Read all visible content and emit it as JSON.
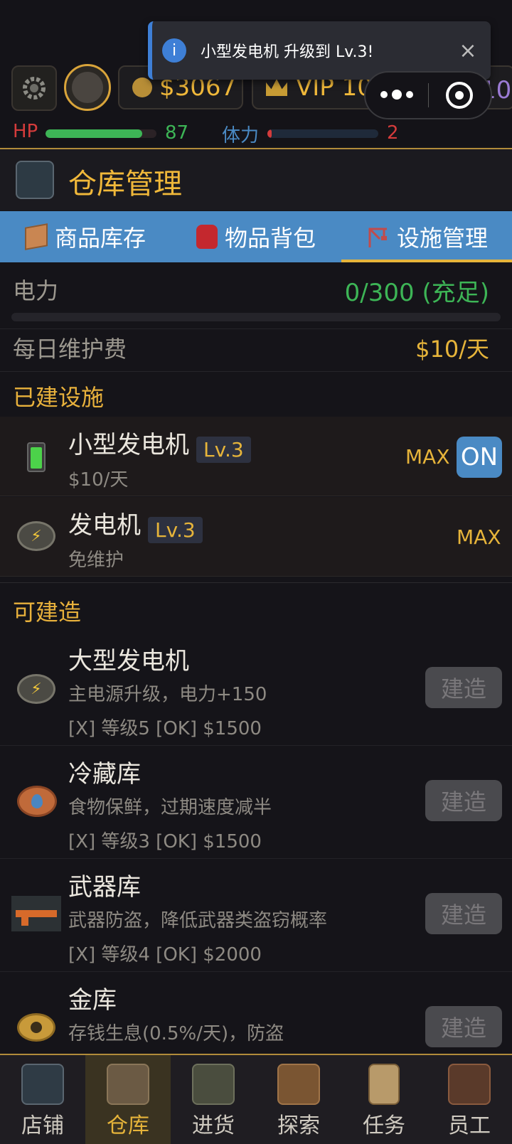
{
  "toast": {
    "icon": "info-icon",
    "message": "小型发电机 升级到 Lv.3!",
    "close": "×"
  },
  "top": {
    "money": "$3067",
    "vip": "VIP 10",
    "reputation": "声望：10",
    "hp_label": "HP",
    "hp_value": "87",
    "hp_fraction": 0.87,
    "stamina_label": "体力",
    "stamina_value": "2",
    "stamina_fraction": 0.02
  },
  "header": {
    "title": "仓库管理"
  },
  "tabs": [
    {
      "label": "商品库存",
      "icon": "box-icon"
    },
    {
      "label": "物品背包",
      "icon": "backpack-icon"
    },
    {
      "label": "设施管理",
      "icon": "crane-icon",
      "active": true
    }
  ],
  "power": {
    "label": "电力",
    "value": "0/300 (充足)",
    "fraction": 0.0
  },
  "maintenance": {
    "label": "每日维护费",
    "value": "$10/天"
  },
  "built": {
    "title": "已建设施",
    "items": [
      {
        "name": "小型发电机",
        "level": "Lv.3",
        "sub": "$10/天",
        "status": "MAX",
        "toggle": "ON",
        "icon": "battery-icon"
      },
      {
        "name": "发电机",
        "level": "Lv.3",
        "sub": "免维护",
        "status": "MAX",
        "icon": "energy-badge-icon"
      }
    ]
  },
  "buildable": {
    "title": "可建造",
    "button": "建造",
    "items": [
      {
        "name": "大型发电机",
        "desc": "主电源升级，电力+150",
        "req": "[X] 等级5  [OK] $1500",
        "icon": "energy-badge-icon"
      },
      {
        "name": "冷藏库",
        "desc": "食物保鲜，过期速度减半",
        "req": "[X] 等级3  [OK] $1500",
        "icon": "water-drop-badge-icon"
      },
      {
        "name": "武器库",
        "desc": "武器防盗，降低武器类盗窃概率",
        "req": "[X] 等级4  [OK] $2000",
        "icon": "rifle-icon"
      },
      {
        "name": "金库",
        "desc": "存钱生息(0.5%/天)，防盗",
        "req": "",
        "icon": "skull-coin-icon"
      }
    ]
  },
  "nav": [
    {
      "label": "店铺",
      "icon": "shop-icon"
    },
    {
      "label": "仓库",
      "icon": "crate-icon",
      "active": true
    },
    {
      "label": "进货",
      "icon": "truck-icon"
    },
    {
      "label": "探索",
      "icon": "map-icon"
    },
    {
      "label": "任务",
      "icon": "clipboard-icon"
    },
    {
      "label": "员工",
      "icon": "team-icon"
    }
  ],
  "colors": {
    "accent": "#e6b43a",
    "tab_bg": "#4a8ac4",
    "green": "#3db556",
    "red": "#d43b3b"
  }
}
